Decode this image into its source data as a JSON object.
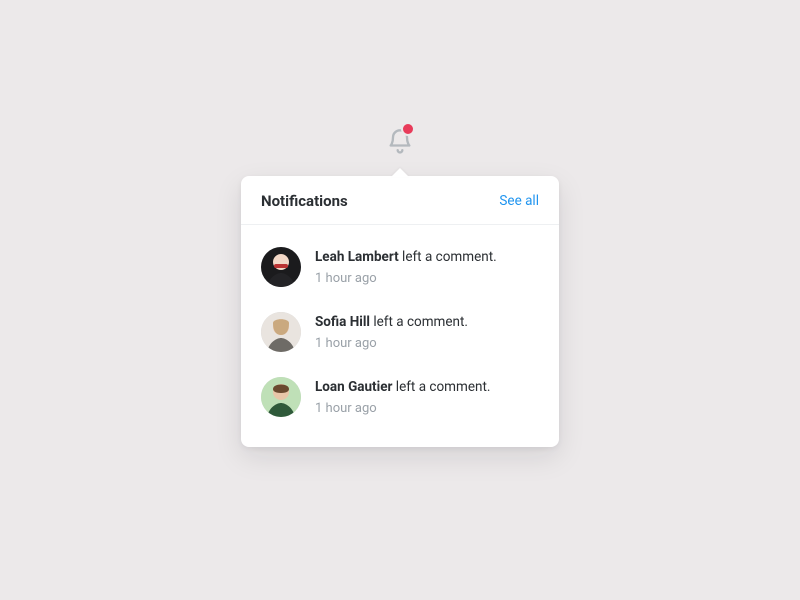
{
  "colors": {
    "accent": "#1f94ef",
    "badge": "#e83b5a",
    "icon": "#b4b9be"
  },
  "bell": {
    "name": "bell-icon",
    "has_unread": true
  },
  "panel": {
    "title": "Notifications",
    "see_all_label": "See all"
  },
  "notifications": [
    {
      "user": "Leah Lambert",
      "action": "left a comment.",
      "time": "1 hour ago"
    },
    {
      "user": "Sofia Hill",
      "action": "left a comment.",
      "time": "1 hour ago"
    },
    {
      "user": "Loan Gautier",
      "action": "left a comment.",
      "time": "1 hour ago"
    }
  ]
}
